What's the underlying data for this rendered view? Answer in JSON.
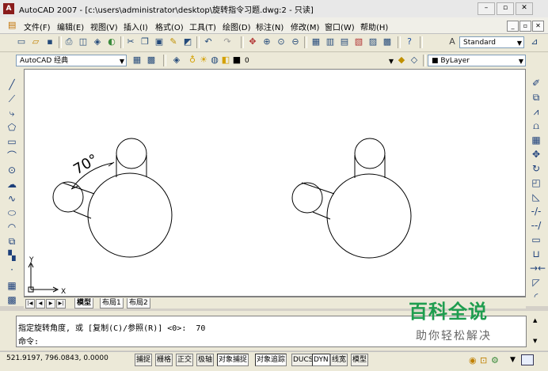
{
  "window": {
    "title": "AutoCAD 2007 - [c:\\users\\administrator\\desktop\\旋转指令习题.dwg:2 - 只读]",
    "app_icon_text": "A",
    "btn_minimize": "–",
    "btn_restore": "▫",
    "btn_close": "✕"
  },
  "menu": {
    "items": [
      "文件(F)",
      "编辑(E)",
      "视图(V)",
      "插入(I)",
      "格式(O)",
      "工具(T)",
      "绘图(D)",
      "标注(N)",
      "修改(M)",
      "窗口(W)",
      "帮助(H)"
    ],
    "mdi_minimize": "_",
    "mdi_restore": "▫",
    "mdi_close": "✕"
  },
  "toolbar": {
    "text_style": "Standard",
    "workspace": "AutoCAD 经典",
    "layer_value": "0",
    "linetype": "ByLayer"
  },
  "drawing": {
    "angle_label": "70°",
    "ucs_x": "X",
    "ucs_y": "Y"
  },
  "layout_tabs": [
    "模型",
    "布局1",
    "布局2"
  ],
  "command": {
    "line1": "指定旋转角度, 或 [复制(C)/参照(R)] <0>:  70",
    "line2": "命令:"
  },
  "status": {
    "coords": "521.9197, 796.0843, 0.0000",
    "buttons": [
      "捕捉",
      "栅格",
      "正交",
      "极轴",
      "对象捕捉",
      "对象追踪",
      "DUCS",
      "DYN",
      "线宽",
      "模型"
    ]
  },
  "watermark": {
    "title": "百科全说",
    "subtitle": "助你轻松解决"
  }
}
